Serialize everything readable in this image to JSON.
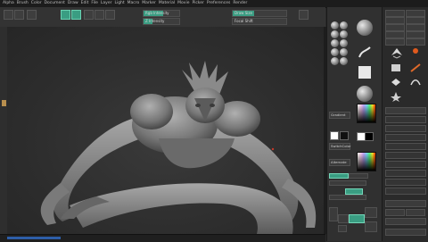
{
  "window": {
    "title": "ZBrush"
  },
  "menu": {
    "items": [
      "Alpha",
      "Brush",
      "Color",
      "Document",
      "Draw",
      "Edit",
      "File",
      "Layer",
      "Light",
      "Macro",
      "Marker",
      "Material",
      "Movie",
      "Picker",
      "Preferences",
      "Render"
    ]
  },
  "top_shelf": {
    "sliders": [
      {
        "label": "Rgb Intensity",
        "fraction": 0.55
      },
      {
        "label": "Z Intensity",
        "fraction": 0.25
      },
      {
        "label": "Draw Size",
        "fraction": 0.4
      },
      {
        "label": "Focal Shift",
        "fraction": 0.0
      }
    ],
    "mode_buttons": [
      "Edit",
      "Draw",
      "Move",
      "Scale",
      "Rotate"
    ]
  },
  "tool_panel": {
    "stroke_label": "DragRect",
    "material_label": "MatCap Gray",
    "buttons": [
      "Gradient",
      "SwitchColor",
      "Alternate"
    ],
    "bottom_buttons": [
      "Solo",
      "Transp",
      "PolyF"
    ]
  },
  "right_panel": {
    "title": "Tool",
    "buttons": [
      "Load Tool",
      "Save As",
      "Copy Tool",
      "Paste Tool",
      "Import",
      "Export",
      "Clone",
      "Make PolyMesh3D",
      "GoZ",
      "All",
      "Visible"
    ]
  },
  "colors": {
    "accent": "#3a9d82",
    "viewport": "#2d2d2d",
    "model": "#8c8c8c"
  }
}
